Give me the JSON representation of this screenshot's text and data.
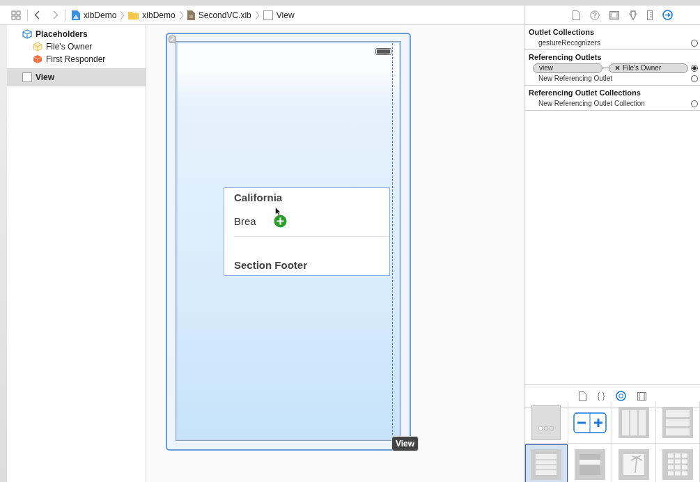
{
  "breadcrumbs": [
    {
      "label": "xibDemo",
      "kind": "project"
    },
    {
      "label": "xibDemo",
      "kind": "folder"
    },
    {
      "label": "SecondVC.xib",
      "kind": "xib"
    },
    {
      "label": "View",
      "kind": "view"
    }
  ],
  "outline": [
    {
      "label": "Placeholders",
      "kind": "group",
      "selected": false,
      "children": [
        {
          "label": "File's Owner",
          "kind": "owner"
        },
        {
          "label": "First Responder",
          "kind": "responder"
        }
      ]
    },
    {
      "label": "View",
      "kind": "view",
      "selected": true
    }
  ],
  "canvas": {
    "table": {
      "header": "California",
      "rows": [
        "Brea"
      ],
      "footer": "Section Footer"
    },
    "badge": "View"
  },
  "inspector": {
    "tabs": [
      {
        "kind": "file",
        "selected": false
      },
      {
        "kind": "help",
        "selected": false
      },
      {
        "kind": "identity",
        "selected": false
      },
      {
        "kind": "attributes",
        "selected": false
      },
      {
        "kind": "size",
        "selected": false
      },
      {
        "kind": "connections",
        "selected": true
      }
    ],
    "sections": [
      {
        "title": "Outlet Collections",
        "rows": [
          {
            "label": "gestureRecognizers",
            "connected": false
          }
        ]
      },
      {
        "title": "Referencing Outlets",
        "rows": [
          {
            "label": "view",
            "target": "File's Owner",
            "connected": true
          },
          {
            "label": "New Referencing Outlet",
            "connected": false
          }
        ]
      },
      {
        "title": "Referencing Outlet Collections",
        "rows": [
          {
            "label": "New Referencing Outlet Collection",
            "connected": false
          }
        ]
      }
    ]
  },
  "library": {
    "tabs": [
      {
        "kind": "file",
        "selected": false
      },
      {
        "kind": "code",
        "selected": false
      },
      {
        "kind": "object",
        "selected": true
      },
      {
        "kind": "media",
        "selected": false
      }
    ],
    "items": [
      {
        "kind": "page-control",
        "selected": false
      },
      {
        "kind": "stepper",
        "selected": false
      },
      {
        "kind": "columns",
        "selected": false
      },
      {
        "kind": "rows",
        "selected": false
      },
      {
        "kind": "table",
        "selected": true
      },
      {
        "kind": "cell",
        "selected": false
      },
      {
        "kind": "image",
        "selected": false
      },
      {
        "kind": "grid",
        "selected": false
      }
    ]
  }
}
